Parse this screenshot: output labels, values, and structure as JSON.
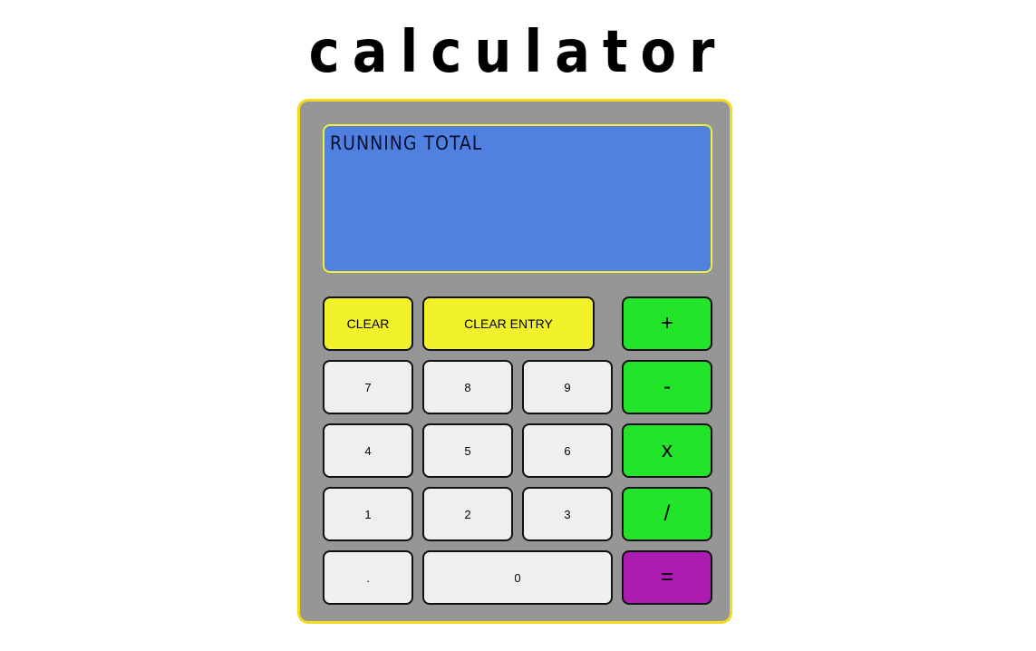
{
  "title": "calculator",
  "display": {
    "text": "Running Total"
  },
  "buttons": {
    "clear": "CLEAR",
    "clear_entry": "CLEAR ENTRY",
    "plus": "+",
    "minus": "-",
    "multiply": "x",
    "divide": "/",
    "equals": "=",
    "seven": "7",
    "eight": "8",
    "nine": "9",
    "four": "4",
    "five": "5",
    "six": "6",
    "one": "1",
    "two": "2",
    "three": "3",
    "decimal": ".",
    "zero": "0"
  },
  "colors": {
    "body": "#969696",
    "border": "#f5da1b",
    "display": "#5080e0",
    "clear_buttons": "#f2f22c",
    "operator_buttons": "#22e52a",
    "equals_button": "#ad1aaf",
    "number_buttons": "#efefef"
  }
}
